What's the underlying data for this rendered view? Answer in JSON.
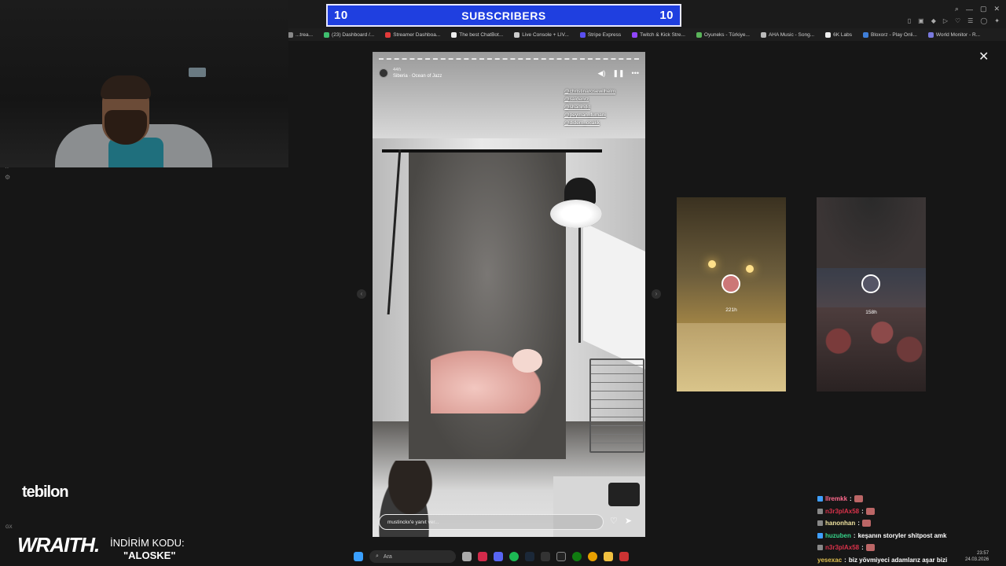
{
  "subscriber_banner": {
    "left_count": "10",
    "title": "SUBSCRIBERS",
    "right_count": "10"
  },
  "bookmarks": [
    {
      "label": "...trea...",
      "color": "#888888"
    },
    {
      "label": "(23) Dashboard /...",
      "color": "#3fbf6f"
    },
    {
      "label": "Streamer Dashboa...",
      "color": "#e23a3a"
    },
    {
      "label": "The best ChatBot...",
      "color": "#eeeeee"
    },
    {
      "label": "Live Console + LIV...",
      "color": "#cccccc"
    },
    {
      "label": "Stripe Express",
      "color": "#5a4ff0"
    },
    {
      "label": "Twitch & Kick Stre...",
      "color": "#9146ff"
    },
    {
      "label": "Oyuneks - Türkiye...",
      "color": "#5ab45a"
    },
    {
      "label": "AHA Music - Song...",
      "color": "#bbbbbb"
    },
    {
      "label": "6K Labs",
      "color": "#eeeeee"
    },
    {
      "label": "Bloxorz - Play Onli...",
      "color": "#3f7fd9"
    },
    {
      "label": "World Monitor - R...",
      "color": "#7a7adf"
    }
  ],
  "story": {
    "time_ago": "44h",
    "music": "Siberia · Ocean of Jazz",
    "mentions": [
      "@christinarosewilhelm",
      "@saidenrz",
      "@shadihdd",
      "@peyman_fumani",
      "@didem_ocakk"
    ],
    "reply_placeholder": "mustinckx'e yanıt ver...",
    "mute_icon": "speaker-icon",
    "pause_icon": "pause-icon",
    "more_icon": "more-icon"
  },
  "side_stories": [
    {
      "time_ago": "221h"
    },
    {
      "time_ago": "158h"
    }
  ],
  "overlay": {
    "tebilon": "tebilon",
    "wraith": "WRAITH.",
    "promo_label": "İNDİRİM KODU:",
    "promo_code": "\"ALOSKE\""
  },
  "chat": [
    {
      "user": "lIremkk",
      "color": "#ff6a8e",
      "text": "",
      "emote": true,
      "badge": "#3f9fff"
    },
    {
      "user": "n3r3plAx58",
      "color": "#d9324a",
      "text": "",
      "emote": true,
      "badge": "#888888"
    },
    {
      "user": "hanonhan",
      "color": "#f0e3a0",
      "text": "",
      "emote": true,
      "badge": "#888888"
    },
    {
      "user": "huzuben",
      "color": "#36d48a",
      "text": "keşanın storyler shitpost amk",
      "emote": false,
      "badge": "#3f9fff"
    },
    {
      "user": "n3r3plAx58",
      "color": "#d9324a",
      "text": "",
      "emote": true,
      "badge": "#888888"
    },
    {
      "user": "yesexac",
      "color": "#e0c050",
      "text": "biz yövmiyeci adamlarız aşar bizi",
      "emote": false,
      "badge": ""
    }
  ],
  "taskbar": {
    "search_placeholder": "Ara",
    "clock_time": "23:57",
    "clock_date": "24.03.2026"
  },
  "sidebar": {
    "gx": "GX"
  }
}
